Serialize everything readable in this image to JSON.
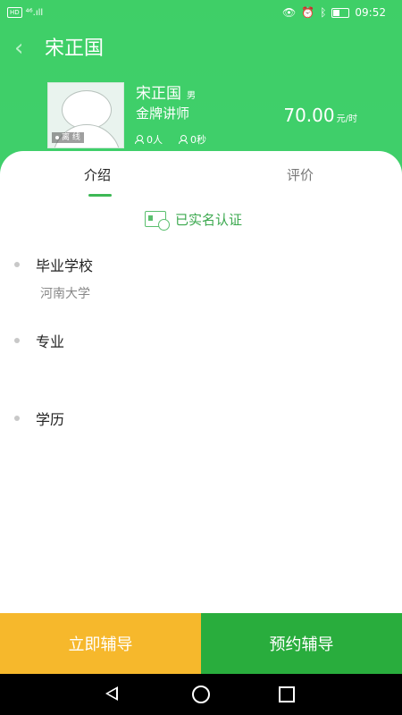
{
  "status_bar": {
    "network_badge": "HD",
    "signal": "⁴⁶.ıll",
    "time": "09:52",
    "icons": [
      "eye-icon",
      "alarm-icon",
      "bluetooth-icon",
      "battery-icon"
    ]
  },
  "header": {
    "title": "宋正国",
    "back_icon": "chevron-left-icon"
  },
  "tutor": {
    "name": "宋正国",
    "gender": "男",
    "rank": "金牌讲师",
    "offline_badge": "离 线",
    "students": "0人",
    "duration": "0秒",
    "price": "70.00",
    "price_unit": "元/时"
  },
  "tabs": {
    "intro": "介绍",
    "review": "评价",
    "active": "intro"
  },
  "verified": {
    "label": "已实名认证",
    "icon": "id-card-check-icon"
  },
  "sections": [
    {
      "title": "毕业学校",
      "value": "河南大学"
    },
    {
      "title": "专业",
      "value": ""
    },
    {
      "title": "学历",
      "value": ""
    }
  ],
  "footer": {
    "tutor_now": "立即辅导",
    "book_tutor": "预约辅导"
  },
  "colors": {
    "primary_green": "#3fcf67",
    "dark_green": "#29ad3d",
    "orange": "#f6b82c",
    "verified_green": "#3aa84d"
  }
}
